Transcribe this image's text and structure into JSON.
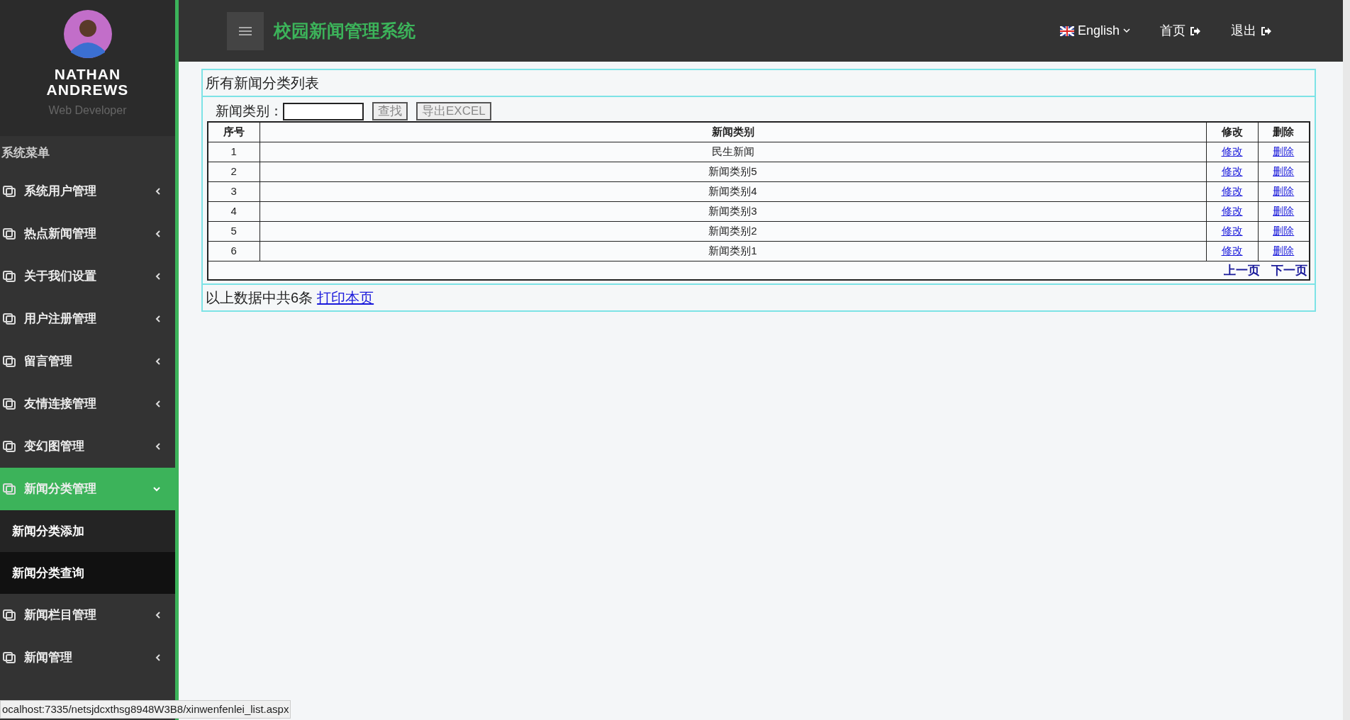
{
  "sidebar": {
    "profile": {
      "name": "NATHAN ANDREWS",
      "role": "Web Developer"
    },
    "menu_title": "系统菜单",
    "items": [
      {
        "label": "系统用户管理",
        "expanded": false
      },
      {
        "label": "热点新闻管理",
        "expanded": false
      },
      {
        "label": "关于我们设置",
        "expanded": false
      },
      {
        "label": "用户注册管理",
        "expanded": false
      },
      {
        "label": "留言管理",
        "expanded": false
      },
      {
        "label": "友情连接管理",
        "expanded": false
      },
      {
        "label": "变幻图管理",
        "expanded": false
      },
      {
        "label": "新闻分类管理",
        "expanded": true,
        "children": [
          {
            "label": "新闻分类添加",
            "selected": false
          },
          {
            "label": "新闻分类查询",
            "selected": true
          }
        ]
      },
      {
        "label": "新闻栏目管理",
        "expanded": false
      },
      {
        "label": "新闻管理",
        "expanded": false
      }
    ]
  },
  "header": {
    "title": "校园新闻管理系统",
    "language": "English",
    "links": [
      "首页",
      "退出"
    ]
  },
  "panel": {
    "title": "所有新闻分类列表",
    "search": {
      "label": "新闻类别：",
      "buttons": [
        "查找",
        "导出EXCEL"
      ]
    },
    "table": {
      "columns": [
        "序号",
        "新闻类别",
        "修改",
        "删除"
      ],
      "rows": [
        [
          "1",
          "民生新闻",
          "修改",
          "删除"
        ],
        [
          "2",
          "新闻类别5",
          "修改",
          "删除"
        ],
        [
          "3",
          "新闻类别4",
          "修改",
          "删除"
        ],
        [
          "4",
          "新闻类别3",
          "修改",
          "删除"
        ],
        [
          "5",
          "新闻类别2",
          "修改",
          "删除"
        ],
        [
          "6",
          "新闻类别1",
          "修改",
          "删除"
        ]
      ],
      "pager": [
        "上一页",
        "下一页"
      ]
    },
    "summary": "以上数据中共6条",
    "print_link": "打印本页"
  },
  "status_bar": "ocalhost:7335/netsjdcxthsg8948W3B8/xinwenfenlei_list.aspx"
}
